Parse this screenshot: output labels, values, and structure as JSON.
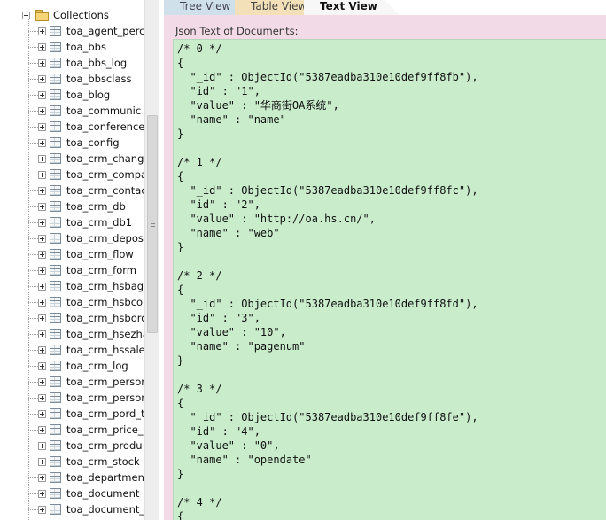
{
  "tree": {
    "root_label": "Collections",
    "items": [
      "toa_agent_perc",
      "toa_bbs",
      "toa_bbs_log",
      "toa_bbsclass",
      "toa_blog",
      "toa_communic",
      "toa_conference",
      "toa_config",
      "toa_crm_chang",
      "toa_crm_compa",
      "toa_crm_contac",
      "toa_crm_db",
      "toa_crm_db1",
      "toa_crm_depos",
      "toa_crm_flow",
      "toa_crm_form",
      "toa_crm_hsbag",
      "toa_crm_hsbco",
      "toa_crm_hsbord",
      "toa_crm_hsezha",
      "toa_crm_hssale",
      "toa_crm_log",
      "toa_crm_persor",
      "toa_crm_persor",
      "toa_crm_pord_t",
      "toa_crm_price_",
      "toa_crm_produ",
      "toa_crm_stock",
      "toa_departmen",
      "toa_document",
      "toa_document_"
    ]
  },
  "tabs": {
    "tree_view": "Tree View",
    "table_view": "Table View",
    "text_view": "Text View",
    "active": "Text View"
  },
  "content": {
    "label": "Json Text of Documents:",
    "documents": [
      {
        "header": "/* 0 */",
        "open": "{",
        "lines": [
          "  \"_id\" : ObjectId(\"5387eadba310e10def9ff8fb\"),",
          "  \"id\" : \"1\",",
          "  \"value\" : \"华商街OA系统\",",
          "  \"name\" : \"name\""
        ],
        "close": "}"
      },
      {
        "header": "/* 1 */",
        "open": "{",
        "lines": [
          "  \"_id\" : ObjectId(\"5387eadba310e10def9ff8fc\"),",
          "  \"id\" : \"2\",",
          "  \"value\" : \"http://oa.hs.cn/\",",
          "  \"name\" : \"web\""
        ],
        "close": "}"
      },
      {
        "header": "/* 2 */",
        "open": "{",
        "lines": [
          "  \"_id\" : ObjectId(\"5387eadba310e10def9ff8fd\"),",
          "  \"id\" : \"3\",",
          "  \"value\" : \"10\",",
          "  \"name\" : \"pagenum\""
        ],
        "close": "}"
      },
      {
        "header": "/* 3 */",
        "open": "{",
        "lines": [
          "  \"_id\" : ObjectId(\"5387eadba310e10def9ff8fe\"),",
          "  \"id\" : \"4\",",
          "  \"value\" : \"0\",",
          "  \"name\" : \"opendate\""
        ],
        "close": "}"
      },
      {
        "header": "/* 4 */",
        "open": "{",
        "lines": [],
        "close": ""
      }
    ]
  },
  "colors": {
    "text_bg": "#c9eccb",
    "frame_bg": "#f2dbe6",
    "tab_tree_bg": "#cfe0ea",
    "tab_table_bg": "#f3e0b8"
  }
}
